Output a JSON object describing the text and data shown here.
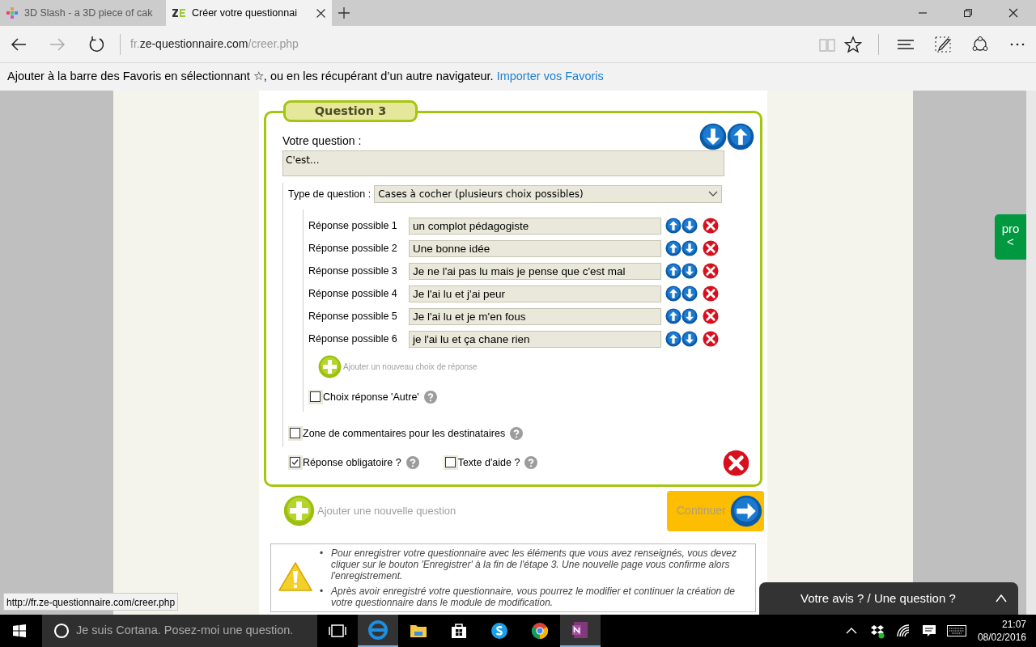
{
  "browser": {
    "tabs": [
      {
        "title": "3D Slash - a 3D piece of cak",
        "selected": false,
        "kind": "slash"
      },
      {
        "title": "Créer votre questionnai",
        "selected": true,
        "kind": "ze"
      }
    ],
    "address": {
      "prefix": "fr.",
      "domain": "ze-questionnaire.com",
      "path": "/creer.php"
    },
    "favorites_bar": {
      "text": "Ajouter à la barre des Favoris en sélectionnant ☆, ou en les récupérant d’un autre navigateur.",
      "link": "Importer vos Favoris"
    }
  },
  "question": {
    "legend": "Question 3",
    "label": "Votre question :",
    "value": "C'est...",
    "type_label": "Type de question :",
    "type_value": "Cases à cocher (plusieurs choix possibles)",
    "answers": [
      {
        "label": "Réponse possible 1",
        "value": "un complot pédagogiste"
      },
      {
        "label": "Réponse possible 2",
        "value": "Une bonne idée"
      },
      {
        "label": "Réponse possible 3",
        "value": "Je ne l'ai pas lu mais je pense que c'est mal"
      },
      {
        "label": "Réponse possible 4",
        "value": "Je l'ai lu et j'ai peur"
      },
      {
        "label": "Réponse possible 5",
        "value": "Je l'ai lu et je m'en fous"
      },
      {
        "label": "Réponse possible 6",
        "value": "je l'ai lu et ça chane rien"
      }
    ],
    "add_answer": "Ajouter un nouveau choix de réponse",
    "other_option": {
      "label": "Choix réponse 'Autre'",
      "checked": false
    },
    "comments_option": {
      "label": "Zone de commentaires pour les destinataires",
      "checked": false
    },
    "required_option": {
      "label": "Réponse obligatoire ?",
      "checked": true
    },
    "help_option": {
      "label": "Texte d'aide ?",
      "checked": false
    }
  },
  "add_question": "Ajouter une nouvelle question",
  "continue_button": "Continuer",
  "notice_marker": "•",
  "notice": [
    "Pour enregistrer votre questionnaire avec les éléments que vous avez renseignés, vous devez cliquer sur le bouton 'Enregistrer' à la fin de l'étape 3. Une nouvelle page vous confirme alors l'enregistrement.",
    "Après avoir enregistré votre questionnaire, vous pourrez le modifier et continuer la création de votre questionnaire dans le module de modification."
  ],
  "pro_tab": {
    "label": "pro",
    "arrow": "<"
  },
  "feedback_bar": "Votre avis ? / Une question ?",
  "status_url": "http://fr.ze-questionnaire.com/creer.php",
  "taskbar": {
    "search_placeholder": "Je suis Cortana. Posez-moi une question.",
    "time": "21:07",
    "date": "08/02/2016"
  }
}
